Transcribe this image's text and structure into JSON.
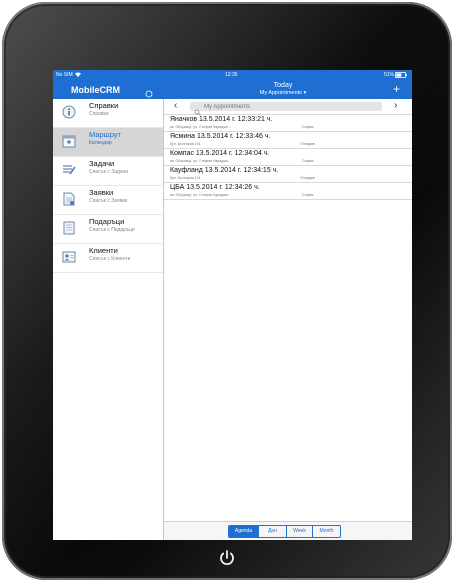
{
  "status": {
    "carrier": "No SIM",
    "time": "12:35",
    "battery": "51%"
  },
  "nav": {
    "app_title": "MobileCRM",
    "title": "Today",
    "subtitle": "My Appointments"
  },
  "sidebar": {
    "items": [
      {
        "label": "Справки",
        "sub": "Справки",
        "icon": "info-icon",
        "active": false
      },
      {
        "label": "Маршрут",
        "sub": "Календар",
        "icon": "calendar-icon",
        "active": true
      },
      {
        "label": "Задачи",
        "sub": "Списък с Задачи",
        "icon": "tasks-icon",
        "active": false
      },
      {
        "label": "Заявки",
        "sub": "Списък с Заявки",
        "icon": "requests-icon",
        "active": false
      },
      {
        "label": "Подаръци",
        "sub": "Списък с Подаръци",
        "icon": "gifts-icon",
        "active": false
      },
      {
        "label": "Клиенти",
        "sub": "Списък с Клиенти",
        "icon": "clients-icon",
        "active": false
      }
    ]
  },
  "search": {
    "placeholder": "My Appointments"
  },
  "appointments": [
    {
      "title": "Яначков 13.5.2014 г. 12:33:21 ч.",
      "address": "кв. Оборище, ул. Стефан Караджа...",
      "city": "София"
    },
    {
      "title": "Ясмина 13.5.2014 г. 12:33:46 ч.",
      "address": "бул. България 191",
      "city": "Пловдив"
    },
    {
      "title": "Компас 13.5.2014 г. 12:34:04 ч.",
      "address": "кв. Оборище, ул. Стефан Караджа...",
      "city": "София"
    },
    {
      "title": "Кауфланд 13.5.2014 г. 12:34:15 ч.",
      "address": "бул. България 191",
      "city": "Пловдив"
    },
    {
      "title": "ЦБА 13.5.2014 г. 12:34:26 ч.",
      "address": "кв. Оборище, ул. Стефан Караджа...",
      "city": "София"
    }
  ],
  "views": [
    {
      "label": "Agenda",
      "active": true
    },
    {
      "label": "Ден",
      "active": false
    },
    {
      "label": "Week",
      "active": false
    },
    {
      "label": "Month",
      "active": false
    }
  ],
  "colors": {
    "accent": "#1f6fd3",
    "active_row": "#d6d6d6"
  }
}
